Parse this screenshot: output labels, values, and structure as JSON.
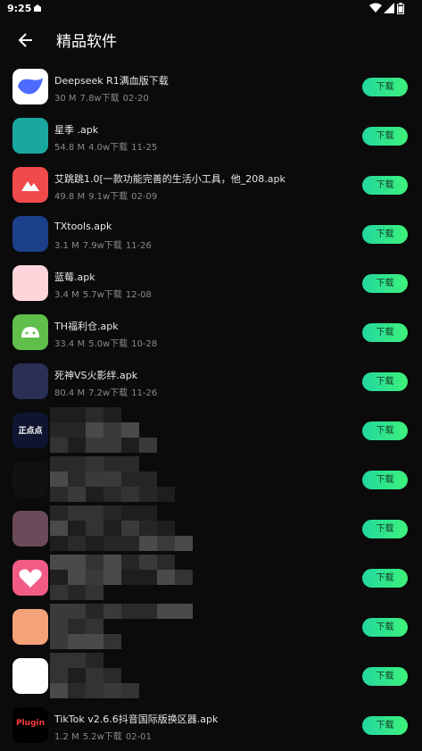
{
  "status_bar": {
    "time": "9:25",
    "icons": [
      "notification-icon",
      "wifi-icon",
      "signal-icon",
      "battery-icon"
    ]
  },
  "header": {
    "title": "精品软件",
    "back_icon": "arrow-left-icon"
  },
  "download_label": "下载",
  "items": [
    {
      "name": "Deepseek R1满血版下载",
      "size": "30 M",
      "downloads": "7.8w下载",
      "date": "02-20",
      "icon": "deepseek-whale-icon",
      "color": "#4d6bfe"
    },
    {
      "name": "星季 .apk",
      "size": "54.8 M",
      "downloads": "4.0w下载",
      "date": "11-25",
      "icon": "star-app-icon",
      "color": "#1aa7a0"
    },
    {
      "name": "艾跳跳1.0[一款功能完善的生活小工具，他_208.apk",
      "size": "49.8 M",
      "downloads": "9.1w下载",
      "date": "02-09",
      "icon": "mountain-app-icon",
      "color": "#f04a4a"
    },
    {
      "name": "TXtools.apk",
      "size": "3.1 M",
      "downloads": "7.9w下载",
      "date": "11-26",
      "icon": "dragon-app-icon",
      "color": "#1c3f8a"
    },
    {
      "name": "蓝莓.apk",
      "size": "3.4 M",
      "downloads": "5.7w下载",
      "date": "12-08",
      "icon": "blueberry-app-icon",
      "color": "#ffd5dc"
    },
    {
      "name": "TH福利仓.apk",
      "size": "33.4 M",
      "downloads": "5.0w下载",
      "date": "10-28",
      "icon": "android-icon",
      "color": "#5fbf4a"
    },
    {
      "name": "死神VS火影绊.apk",
      "size": "80.4 M",
      "downloads": "7.2w下载",
      "date": "11-26",
      "icon": "anime-game-icon",
      "color": "#2a2f55"
    },
    {
      "name": "",
      "size": "",
      "downloads": "",
      "date": "",
      "icon": "zhengdiandian-app-icon",
      "color": "#0f1530",
      "icon_text": "正点点"
    },
    {
      "name": "",
      "size": "",
      "downloads": "",
      "date": "",
      "icon": "pink-b-app-icon",
      "color": "#111111"
    },
    {
      "name": "",
      "size": "",
      "downloads": "",
      "date": "",
      "icon": "anime-face-icon",
      "color": "#6b4a5a"
    },
    {
      "name": "",
      "size": "",
      "downloads": "",
      "date": "",
      "icon": "heart-app-icon",
      "color": "#f25b86"
    },
    {
      "name": "",
      "size": "",
      "downloads": "",
      "date": "",
      "icon": "anime-girl-icon",
      "color": "#f3a27a"
    },
    {
      "name": "",
      "size": "",
      "downloads": "",
      "date": "",
      "icon": "red-badge-app-icon",
      "color": "#ffffff"
    },
    {
      "name": "TikTok v2.6.6抖音国际版换区器.apk",
      "size": "1.2 M",
      "downloads": "5.2w下载",
      "date": "02-01",
      "icon": "plugin-icon",
      "color": "#000000",
      "icon_text": "Plugin"
    }
  ]
}
